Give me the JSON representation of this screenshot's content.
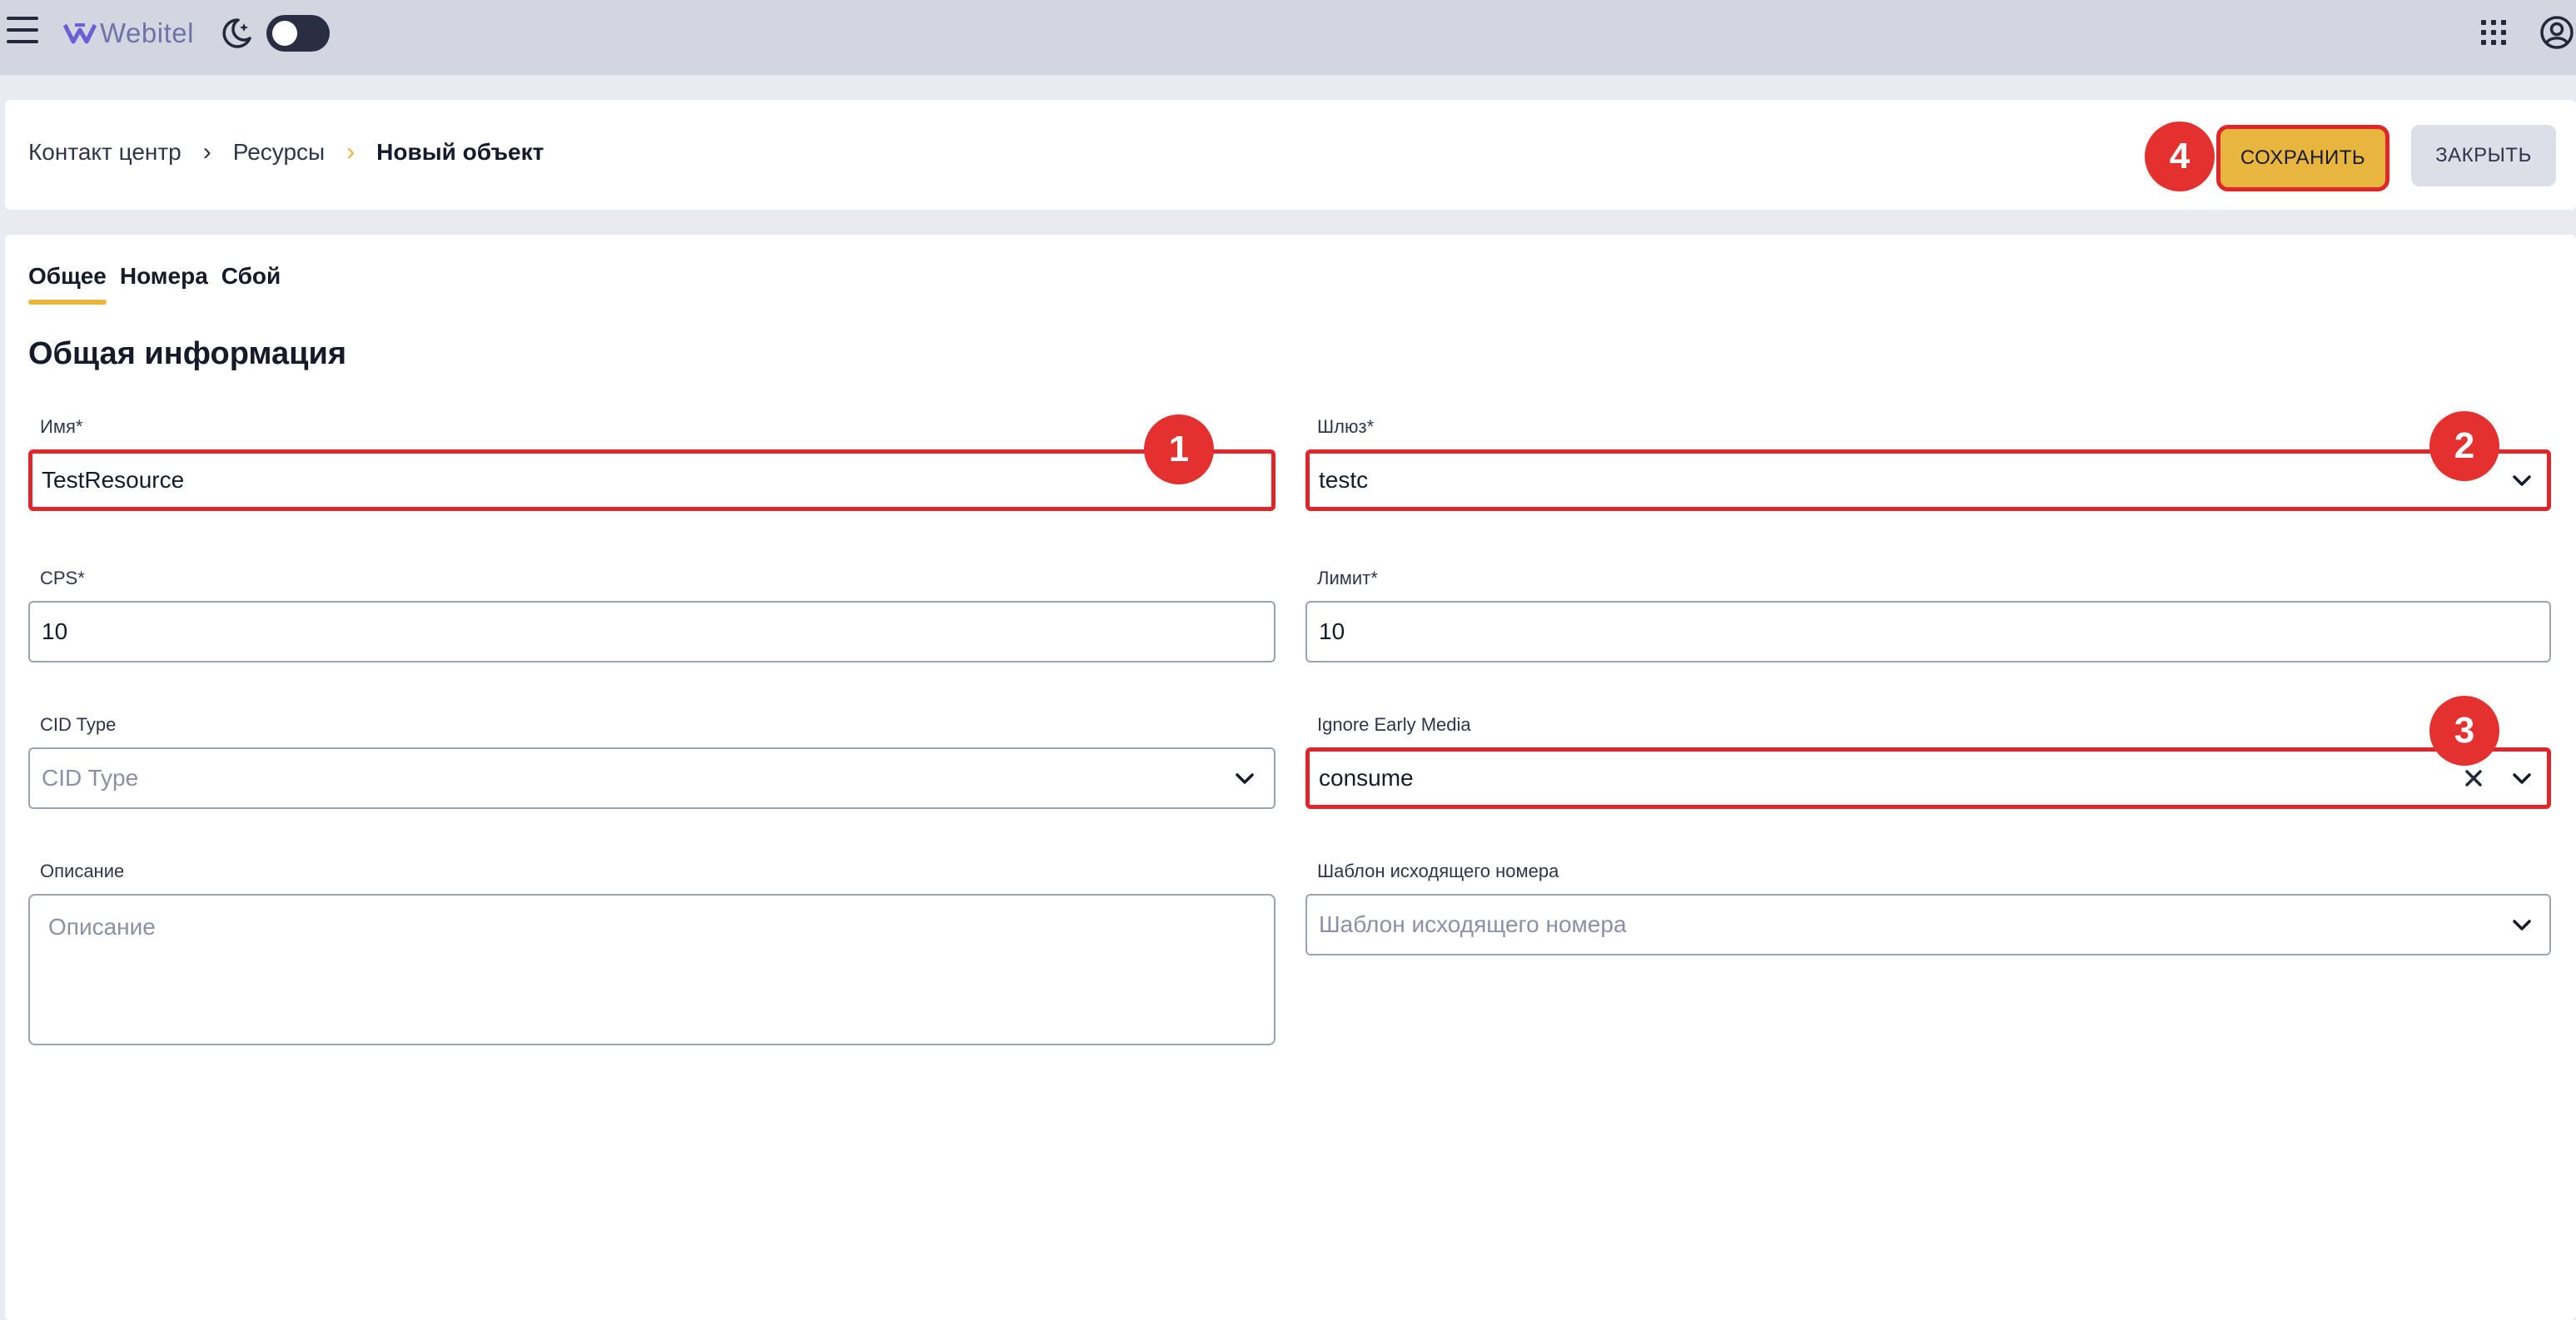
{
  "topbar": {
    "logo_text": "Webitel",
    "icons": [
      "menu-icon",
      "webitel-logo-icon",
      "moon-icon",
      "theme-toggle",
      "apps-grid-icon",
      "account-icon"
    ],
    "theme_toggle": "off"
  },
  "header": {
    "breadcrumbs": [
      "Контакт центр",
      "Ресурсы",
      "Новый объект"
    ],
    "save_label": "СОХРАНИТЬ",
    "close_label": "ЗАКРЫТЬ"
  },
  "tabs": [
    {
      "label": "Общее",
      "active": true
    },
    {
      "label": "Номера",
      "active": false
    },
    {
      "label": "Сбой",
      "active": false
    }
  ],
  "section_title": "Общая информация",
  "form": {
    "name": {
      "label": "Имя*",
      "value": "TestResource"
    },
    "gateway": {
      "label": "Шлюз*",
      "value": "testc"
    },
    "cps": {
      "label": "CPS*",
      "value": "10"
    },
    "limit": {
      "label": "Лимит*",
      "value": "10"
    },
    "cid_type": {
      "label": "CID Type",
      "placeholder": "CID Type"
    },
    "ignore_early_media": {
      "label": "Ignore Early Media",
      "value": "consume"
    },
    "description": {
      "label": "Описание",
      "placeholder": "Описание"
    },
    "outgoing_template": {
      "label": "Шаблон исходящего номера",
      "placeholder": "Шаблон исходящего номера"
    }
  },
  "markers": [
    "1",
    "2",
    "3",
    "4"
  ],
  "colors": {
    "accent": "#e8b63e",
    "highlight_border": "#e0262a",
    "marker_fill": "#e53030",
    "topbar": "#d3d5e1"
  }
}
